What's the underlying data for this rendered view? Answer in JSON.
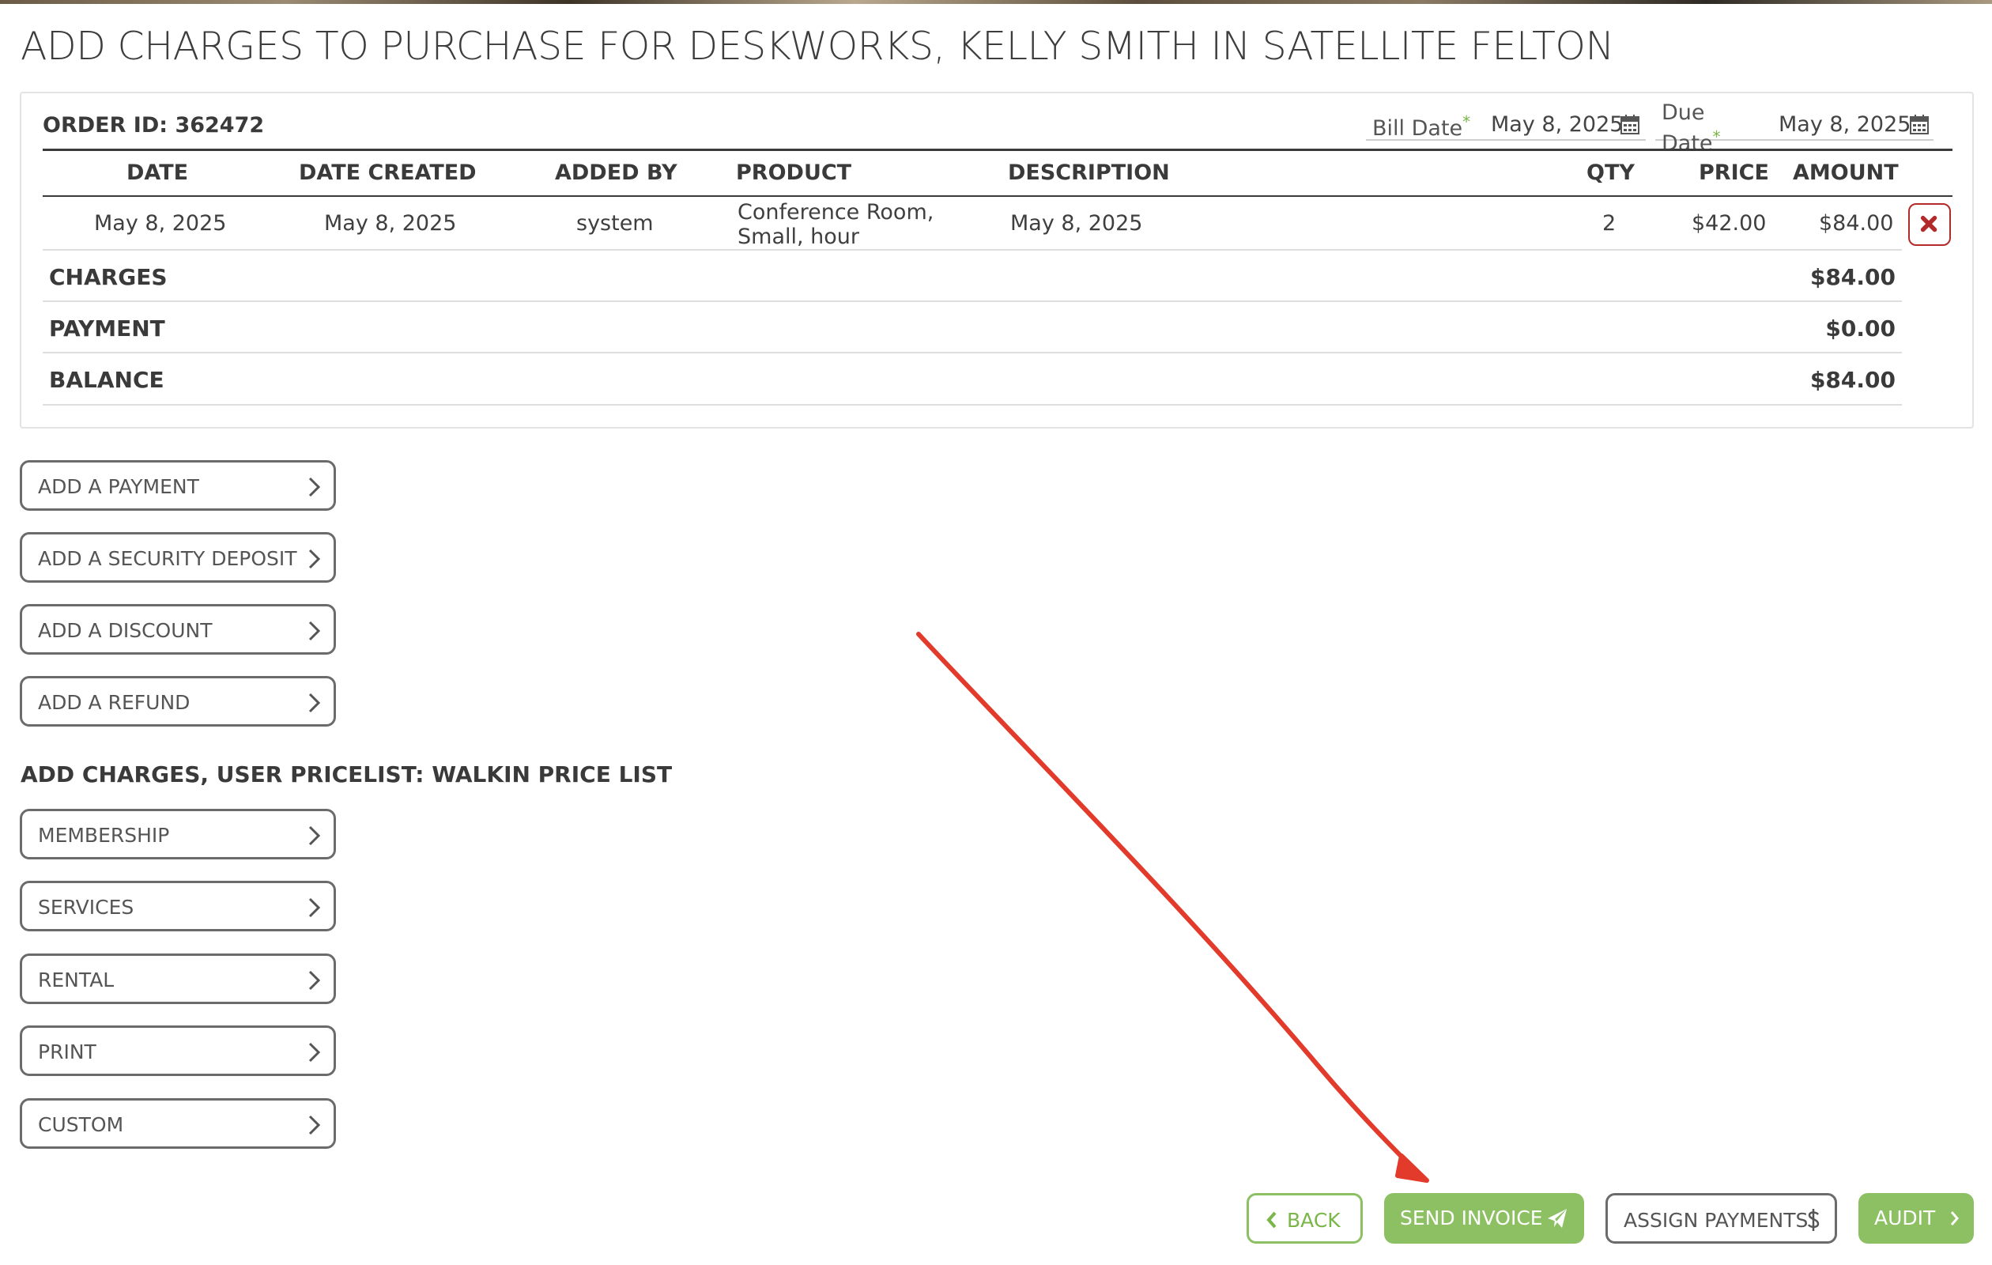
{
  "page": {
    "title": "ADD CHARGES TO PURCHASE FOR DESKWORKS, KELLY SMITH IN SATELLITE FELTON"
  },
  "order": {
    "id_label": "ORDER ID: 362472",
    "bill_date_label": "Bill Date",
    "bill_date_value": "May 8, 2025",
    "due_date_label_line1": "Due",
    "due_date_label_line2": "Date",
    "due_date_value": "May 8, 2025",
    "required_mark": "*"
  },
  "table": {
    "headers": {
      "date": "DATE",
      "date_created": "DATE CREATED",
      "added_by": "ADDED BY",
      "product": "PRODUCT",
      "description": "DESCRIPTION",
      "qty": "QTY",
      "price": "PRICE",
      "amount": "AMOUNT"
    },
    "rows": [
      {
        "date": "May 8, 2025",
        "date_created": "May 8, 2025",
        "added_by": "system",
        "product_line1": "Conference Room,",
        "product_line2": "Small, hour",
        "description": "May 8, 2025",
        "qty": "2",
        "price": "$42.00",
        "amount": "$84.00"
      }
    ],
    "delete_icon": "times-icon"
  },
  "summary": {
    "charges_label": "CHARGES",
    "charges_value": "$84.00",
    "payment_label": "PAYMENT",
    "payment_value": "$0.00",
    "balance_label": "BALANCE",
    "balance_value": "$84.00"
  },
  "actions": [
    {
      "label": "ADD A PAYMENT"
    },
    {
      "label": "ADD A SECURITY DEPOSIT"
    },
    {
      "label": "ADD A DISCOUNT"
    },
    {
      "label": "ADD A REFUND"
    }
  ],
  "charges_section": {
    "heading": "ADD CHARGES, USER PRICELIST: WALKIN PRICE LIST",
    "categories": [
      {
        "label": "MEMBERSHIP"
      },
      {
        "label": "SERVICES"
      },
      {
        "label": "RENTAL"
      },
      {
        "label": "PRINT"
      },
      {
        "label": "CUSTOM"
      }
    ]
  },
  "footer": {
    "back_label": "BACK",
    "send_invoice_label": "SEND INVOICE",
    "assign_payments_label": "ASSIGN PAYMENTS",
    "audit_label": "AUDIT"
  },
  "colors": {
    "accent_green": "#8cc063",
    "delete_red": "#b22a2a",
    "annotation_red": "#e23a2b"
  },
  "icons": {
    "calendar": "calendar-icon",
    "chevron": "chevron-right-icon",
    "send": "paper-plane-icon",
    "dollar": "dollar-icon",
    "back": "chevron-left-icon"
  }
}
